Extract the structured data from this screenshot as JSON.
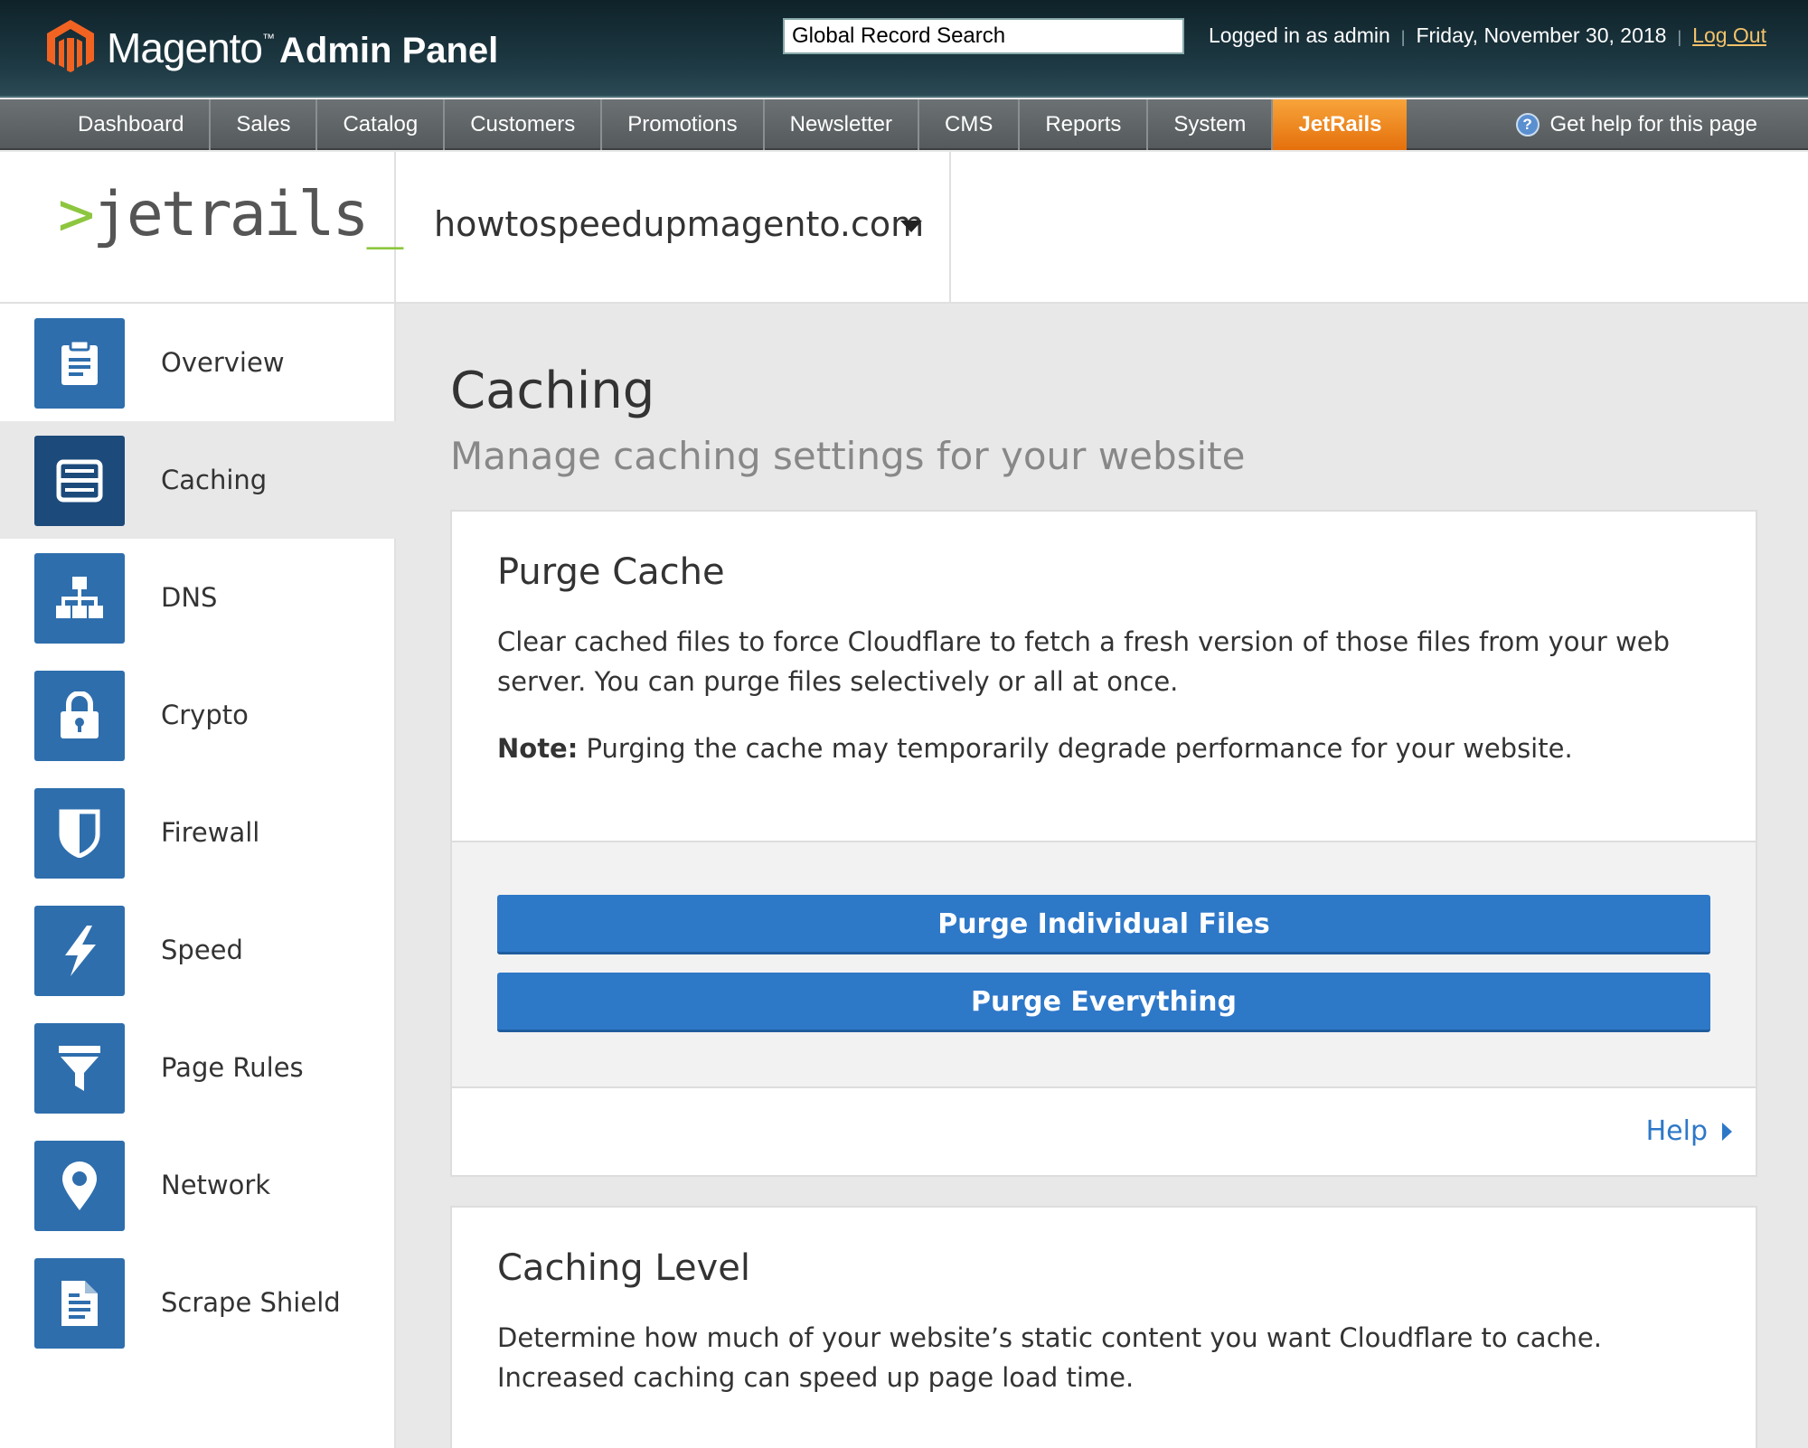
{
  "header": {
    "brand": "Magento",
    "brand_suffix": "Admin Panel",
    "search_value": "Global Record Search",
    "logged_in": "Logged in as admin",
    "date": "Friday, November 30, 2018",
    "logout": "Log Out",
    "logo_color": "#f26322"
  },
  "nav": {
    "items": [
      "Dashboard",
      "Sales",
      "Catalog",
      "Customers",
      "Promotions",
      "Newsletter",
      "CMS",
      "Reports",
      "System",
      "JetRails"
    ],
    "active": "JetRails",
    "help": "Get help for this page"
  },
  "jetrails": {
    "logo_prefix": ">",
    "logo_text": "jetrails",
    "logo_suffix": "_",
    "domain": "howtospeedupmagento.com"
  },
  "sidebar": {
    "items": [
      {
        "label": "Overview",
        "icon": "clipboard-icon"
      },
      {
        "label": "Caching",
        "icon": "server-icon"
      },
      {
        "label": "DNS",
        "icon": "network-tree-icon"
      },
      {
        "label": "Crypto",
        "icon": "lock-icon"
      },
      {
        "label": "Firewall",
        "icon": "shield-icon"
      },
      {
        "label": "Speed",
        "icon": "lightning-icon"
      },
      {
        "label": "Page Rules",
        "icon": "funnel-icon"
      },
      {
        "label": "Network",
        "icon": "location-pin-icon"
      },
      {
        "label": "Scrape Shield",
        "icon": "document-icon"
      }
    ],
    "selected": "Caching"
  },
  "main": {
    "title": "Caching",
    "subtitle": "Manage caching settings for your website",
    "purge": {
      "heading": "Purge Cache",
      "description": "Clear cached files to force Cloudflare to fetch a fresh version of those files from your web server. You can purge files selectively or all at once.",
      "note_label": "Note:",
      "note_text": " Purging the cache may temporarily degrade performance for your website.",
      "btn_individual": "Purge Individual Files",
      "btn_everything": "Purge Everything",
      "help": "Help"
    },
    "level": {
      "heading": "Caching Level",
      "description": "Determine how much of your website’s static content you want Cloudflare to cache. Increased caching can speed up page load time."
    }
  },
  "colors": {
    "accent_blue": "#2e78c8",
    "sidebar_icon_bg": "#2e6ead",
    "nav_active": "#e5700c",
    "jetrails_green": "#8dc63f"
  }
}
